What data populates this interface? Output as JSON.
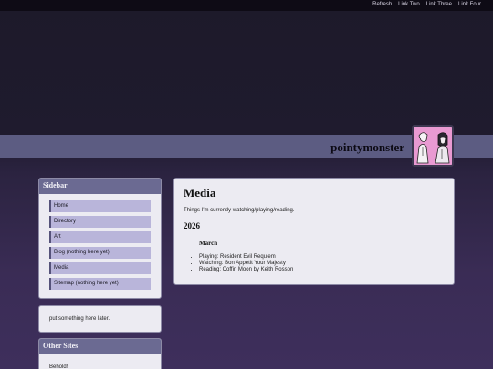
{
  "topnav": [
    "Refresh",
    "Link Two",
    "Link Three",
    "Link Four"
  ],
  "site_title": "pointymonster",
  "sidebar": {
    "title": "Sidebar",
    "items": [
      "Home",
      "Directory",
      "Art",
      "Blog (nothing here yet)",
      "Media",
      "Sitemap (nothing here yet)"
    ]
  },
  "note": "put something here later.",
  "other_sites": {
    "title": "Other Sites",
    "text": "Behold!"
  },
  "main": {
    "title": "Media",
    "intro": "Things I'm currently watching/playing/reading.",
    "year": "2026",
    "month": "March",
    "items": [
      "Playing: Resident Evil Requiem",
      "Watching: Bon Appetit Your Majesty",
      "Reading: Coffin Moon by Keith Rosson"
    ]
  }
}
